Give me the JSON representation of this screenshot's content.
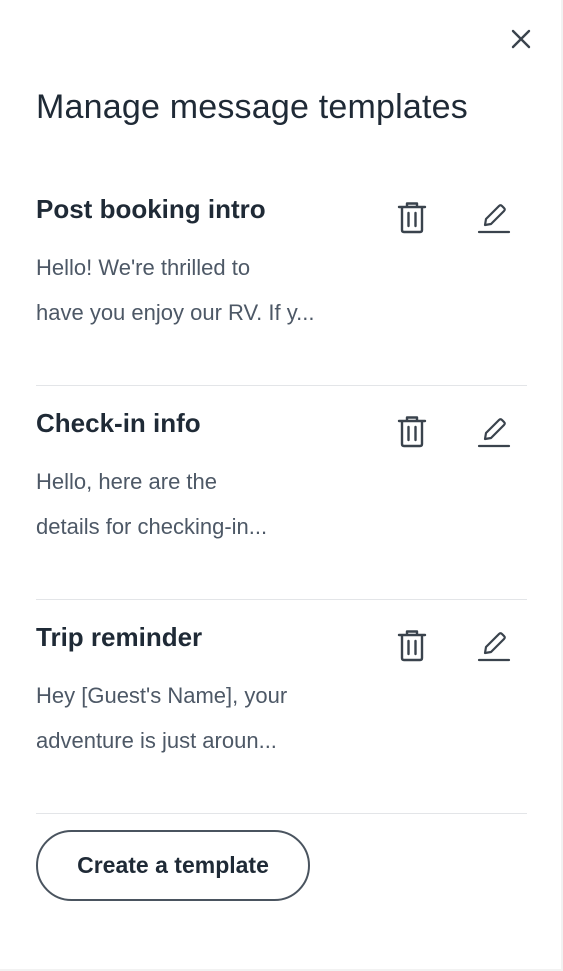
{
  "modal": {
    "title": "Manage message templates",
    "close_icon": "close-icon"
  },
  "templates": [
    {
      "name": "Post booking intro",
      "preview_line1": "Hello! We're thrilled to",
      "preview_line2": "have you enjoy our RV. If y..."
    },
    {
      "name": "Check-in info",
      "preview_line1": "Hello, here are the",
      "preview_line2": "details for checking-in..."
    },
    {
      "name": "Trip reminder",
      "preview_line1": "Hey [Guest's Name], your",
      "preview_line2": "adventure is just aroun..."
    }
  ],
  "actions": {
    "create_label": "Create a template"
  },
  "colors": {
    "text_primary": "#1f2a36",
    "text_secondary": "#4d5866",
    "divider": "#e3e5e8",
    "icon": "#3a434d"
  }
}
